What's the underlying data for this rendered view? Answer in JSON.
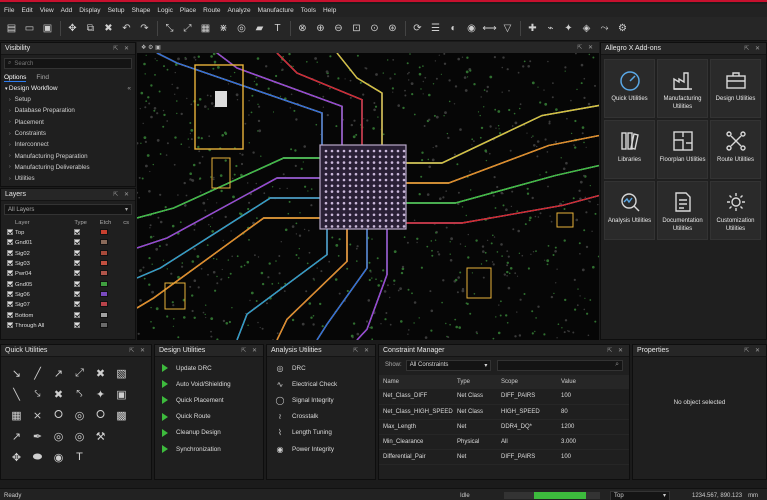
{
  "menu": [
    "File",
    "Edit",
    "View",
    "Add",
    "Display",
    "Setup",
    "Shape",
    "Logic",
    "Place",
    "Route",
    "Analyze",
    "Manufacture",
    "Tools",
    "Help"
  ],
  "toolbar_icons": [
    "new-icon",
    "open-icon",
    "save-icon",
    "move-icon",
    "copy-icon",
    "delete-icon",
    "undo-icon",
    "redo-icon",
    "connect-icon",
    "slide-icon",
    "grid-icon",
    "fanout-icon",
    "via-icon",
    "shape-icon",
    "text-icon",
    "drc-icon",
    "zoom-in-icon",
    "zoom-out-icon",
    "zoom-fit-icon",
    "zoom-prev-icon",
    "zoom-world-icon",
    "refresh-icon",
    "layers-icon",
    "color-icon",
    "visibility-icon",
    "measure-icon",
    "filter-icon",
    "snap-icon",
    "net-icon",
    "highlight-icon",
    "3d-icon",
    "route-icon",
    "settings-icon"
  ],
  "visibility": {
    "title": "Visibility",
    "search_placeholder": "Search",
    "tabs": [
      "Options",
      "Find"
    ],
    "workflow_title": "Design Workflow",
    "items": [
      "Setup",
      "Database Preparation",
      "Placement",
      "Constraints",
      "Interconnect",
      "Manufacturing Preparation",
      "Manufacturing Deliverables",
      "Utilities"
    ]
  },
  "layers": {
    "title": "Layers",
    "filter": "All Layers",
    "headers": [
      "Layer",
      "Type",
      "Etch",
      "cs"
    ],
    "rows": [
      {
        "name": "Top",
        "color": "#c8402f"
      },
      {
        "name": "Gnd01",
        "color": "#8a6a5a"
      },
      {
        "name": "Sig02",
        "color": "#a84a3a"
      },
      {
        "name": "Sig03",
        "color": "#c24f3f"
      },
      {
        "name": "Pwr04",
        "color": "#b0554a"
      },
      {
        "name": "Gnd05",
        "color": "#3f9f3f"
      },
      {
        "name": "Sig06",
        "color": "#7a4abf"
      },
      {
        "name": "Sig07",
        "color": "#b8434a"
      },
      {
        "name": "Bottom",
        "color": "#a0a0a0"
      },
      {
        "name": "Through All",
        "color": "#6a6a6a"
      }
    ]
  },
  "canvas": {
    "tab_label": "❖ ⚙ ▣"
  },
  "addons": {
    "title": "Allegro X Add-ons",
    "items": [
      {
        "label": "Quick Utilities",
        "icon": "gauge-icon"
      },
      {
        "label": "Manufacturing Utilities",
        "icon": "factory-icon"
      },
      {
        "label": "Design Utilities",
        "icon": "toolbox-icon"
      },
      {
        "label": "Libraries",
        "icon": "library-icon"
      },
      {
        "label": "Floorplan Utilities",
        "icon": "floorplan-icon"
      },
      {
        "label": "Route Utilities",
        "icon": "route-icon"
      },
      {
        "label": "Analysis Utilities",
        "icon": "analysis-icon"
      },
      {
        "label": "Documentation Utilities",
        "icon": "document-icon"
      },
      {
        "label": "Customization Utilities",
        "icon": "customize-icon"
      }
    ]
  },
  "quick_utilities": {
    "title": "Quick Utilities",
    "icons": [
      "↘",
      "╱",
      "↗",
      "⤢",
      "✖",
      "▧",
      "╲",
      "⤥",
      "✖",
      "⤣",
      "✦",
      "▣",
      "▦",
      "⨯",
      "⭘",
      "◎",
      "⭘",
      "▩",
      "↗",
      "✒",
      "◎",
      "◎",
      "⚒",
      "",
      "✥",
      "⬬",
      "◉",
      "T",
      "",
      ""
    ]
  },
  "design_utilities": {
    "title": "Design Utilities",
    "items": [
      "Update DRC",
      "Auto Void/Shielding",
      "Quick Placement",
      "Quick Route",
      "Cleanup Design",
      "Synchronization"
    ]
  },
  "analysis_utilities": {
    "title": "Analysis Utilities",
    "items": [
      {
        "label": "DRC",
        "icon": "◎"
      },
      {
        "label": "Electrical Check",
        "icon": "∿"
      },
      {
        "label": "Signal Integrity",
        "icon": "◯"
      },
      {
        "label": "Crosstalk",
        "icon": "≀"
      },
      {
        "label": "Length Tuning",
        "icon": "⌇"
      },
      {
        "label": "Power Integrity",
        "icon": "◉"
      }
    ]
  },
  "constraints": {
    "title": "Constraint Manager",
    "show_label": "Show:",
    "show_value": "All Constraints",
    "headers": [
      "Name",
      "Type",
      "Scope",
      "Value"
    ],
    "rows": [
      [
        "Net_Class_DIFF",
        "Net Class",
        "DIFF_PAIRS",
        "100"
      ],
      [
        "Net_Class_HIGH_SPEED",
        "Net Class",
        "HIGH_SPEED",
        "80"
      ],
      [
        "Max_Length",
        "Net",
        "DDR4_DQ*",
        "1200"
      ],
      [
        "Min_Clearance",
        "Physical",
        "All",
        "3.000"
      ],
      [
        "Differential_Pair",
        "Net",
        "DIFF_PAIRS",
        "100"
      ]
    ]
  },
  "properties": {
    "title": "Properties",
    "empty": "No object selected"
  },
  "status": {
    "left": "Ready",
    "state": "Idle",
    "layer": "Top",
    "coords": "1234.567, 890.123",
    "units": "mm"
  },
  "colors": {
    "accent": "#c8102e",
    "progress": "#3dbb3d"
  }
}
